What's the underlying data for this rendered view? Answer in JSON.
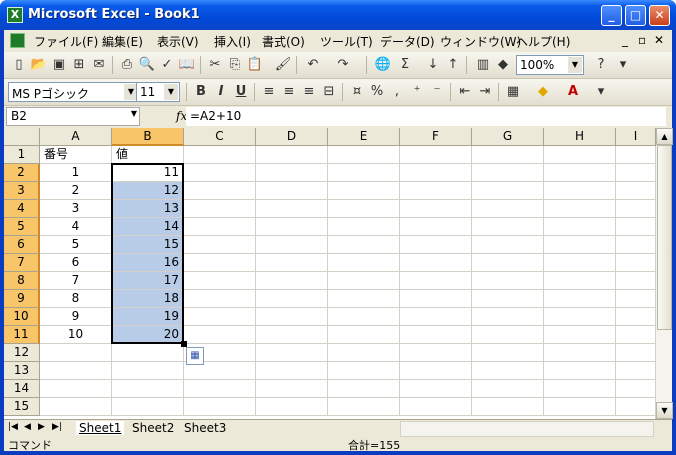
{
  "window": {
    "title": "Microsoft Excel - Book1",
    "controls": {
      "minimize": "_",
      "maximize": "□",
      "close": "✕"
    }
  },
  "menu": {
    "items": [
      "ファイル(F)",
      "編集(E)",
      "表示(V)",
      "挿入(I)",
      "書式(O)",
      "ツール(T)",
      "データ(D)",
      "ウィンドウ(W)",
      "ヘルプ(H)"
    ],
    "mdi_controls": [
      "_",
      "▫",
      "✕"
    ]
  },
  "toolbar": {
    "zoom": "100%",
    "icons": [
      "new-icon",
      "open-icon",
      "save-icon",
      "permission-icon",
      "email-icon",
      "print-icon",
      "print-preview-icon",
      "spelling-icon",
      "research-icon",
      "cut-icon",
      "copy-icon",
      "paste-icon",
      "format-painter-icon",
      "undo-icon",
      "redo-icon",
      "hyperlink-icon",
      "autosum-icon",
      "sort-asc-icon",
      "sort-desc-icon",
      "chart-wizard-icon",
      "drawing-icon",
      "help-icon"
    ]
  },
  "format_toolbar": {
    "font_name": "MS Pゴシック",
    "font_size": "11",
    "bold": "B",
    "italic": "I",
    "underline": "U",
    "percent": "%",
    "comma": ","
  },
  "formula_bar": {
    "name_box": "B2",
    "fx": "fx",
    "formula": "=A2+10"
  },
  "columns": [
    "A",
    "B",
    "C",
    "D",
    "E",
    "F",
    "G",
    "H",
    "I"
  ],
  "rows": [
    "1",
    "2",
    "3",
    "4",
    "5",
    "6",
    "7",
    "8",
    "9",
    "10",
    "11",
    "12",
    "13",
    "14",
    "15"
  ],
  "cells": {
    "A1": "番号",
    "B1": "値",
    "A2": "1",
    "B2": "11",
    "A3": "2",
    "B3": "12",
    "A4": "3",
    "B4": "13",
    "A5": "4",
    "B5": "14",
    "A6": "5",
    "B6": "15",
    "A7": "6",
    "B7": "16",
    "A8": "7",
    "B8": "17",
    "A9": "8",
    "B9": "18",
    "A10": "9",
    "B10": "19",
    "A11": "10",
    "B11": "20"
  },
  "sheets": [
    "Sheet1",
    "Sheet2",
    "Sheet3"
  ],
  "active_sheet": "Sheet1",
  "status": {
    "mode": "コマンド",
    "sum": "合計=155"
  },
  "colors": {
    "title_bar": "#0a5bea",
    "selection_fill": "#b8cce8",
    "header_highlight": "#f8c568",
    "excel_green": "#1f7a2a"
  }
}
